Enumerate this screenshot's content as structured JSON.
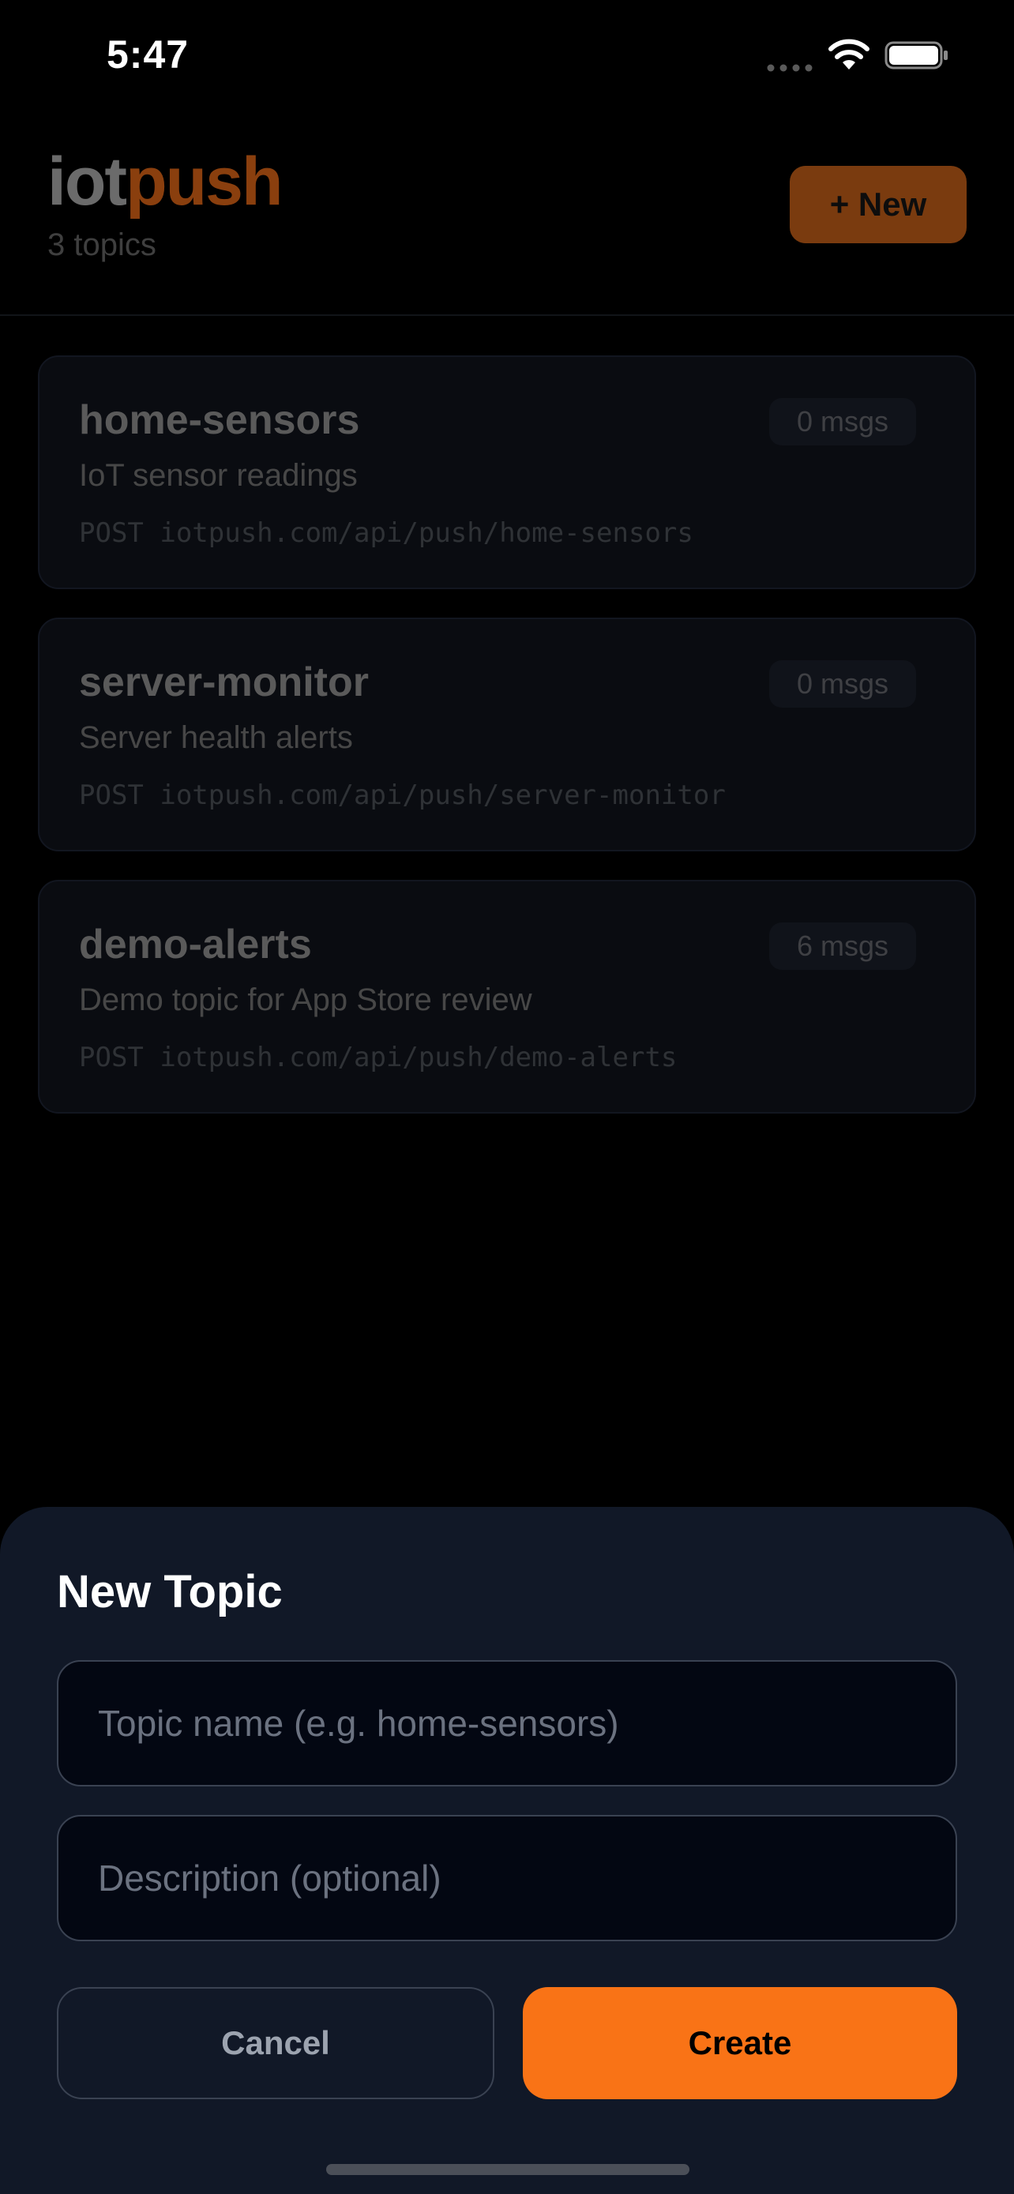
{
  "status_bar": {
    "time": "5:47"
  },
  "header": {
    "title_part1": "iot",
    "title_part2": "push",
    "topic_count": "3 topics",
    "new_button": "+ New"
  },
  "topics": [
    {
      "name": "home-sensors",
      "badge": "0 msgs",
      "description": "IoT sensor readings",
      "endpoint": "POST iotpush.com/api/push/home-sensors"
    },
    {
      "name": "server-monitor",
      "badge": "0 msgs",
      "description": "Server health alerts",
      "endpoint": "POST iotpush.com/api/push/server-monitor"
    },
    {
      "name": "demo-alerts",
      "badge": "6 msgs",
      "description": "Demo topic for App Store review",
      "endpoint": "POST iotpush.com/api/push/demo-alerts"
    }
  ],
  "sheet": {
    "title": "New Topic",
    "name_placeholder": "Topic name (e.g. home-sensors)",
    "description_placeholder": "Description (optional)",
    "cancel": "Cancel",
    "create": "Create"
  },
  "colors": {
    "accent": "#f97316",
    "sheet_bg": "#111827",
    "input_bg": "#030712"
  }
}
